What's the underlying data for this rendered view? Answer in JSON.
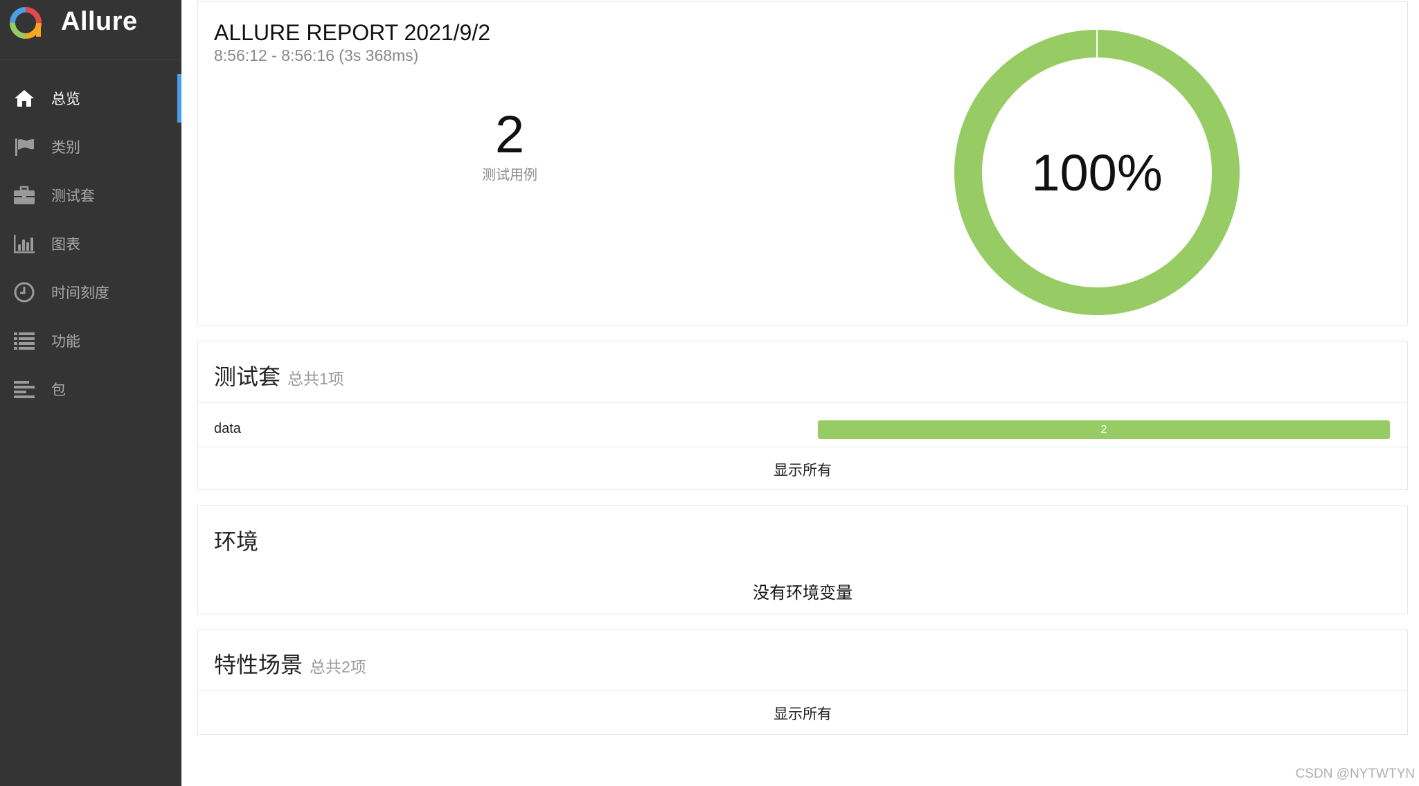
{
  "app": {
    "name": "Allure"
  },
  "sidebar": {
    "items": [
      {
        "label": "总览",
        "icon": "home-icon",
        "active": true
      },
      {
        "label": "类别",
        "icon": "flag-icon"
      },
      {
        "label": "测试套",
        "icon": "briefcase-icon"
      },
      {
        "label": "图表",
        "icon": "bar-chart-icon"
      },
      {
        "label": "时间刻度",
        "icon": "clock-icon"
      },
      {
        "label": "功能",
        "icon": "list-icon"
      },
      {
        "label": "包",
        "icon": "align-left-icon"
      }
    ]
  },
  "summary": {
    "title": "ALLURE REPORT 2021/9/2",
    "time": "8:56:12 - 8:56:16 (3s 368ms)",
    "count": "2",
    "count_label": "测试用例",
    "percent": "100%",
    "pass_rate": 1.0,
    "pass_color": "#97cc64"
  },
  "suites": {
    "title": "测试套",
    "subtitle": "总共1项",
    "rows": [
      {
        "name": "data",
        "count": "2"
      }
    ],
    "show_all": "显示所有"
  },
  "environment": {
    "title": "环境",
    "empty": "没有环境变量"
  },
  "features": {
    "title": "特性场景",
    "subtitle": "总共2项",
    "show_all": "显示所有"
  },
  "watermark": "CSDN @NYTWTYN"
}
